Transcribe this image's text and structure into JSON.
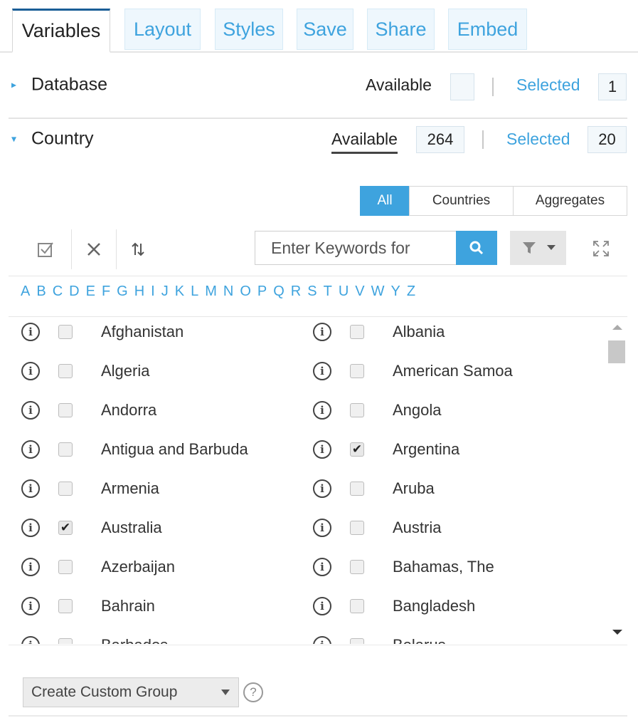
{
  "tabs": [
    {
      "label": "Variables",
      "active": true
    },
    {
      "label": "Layout"
    },
    {
      "label": "Styles"
    },
    {
      "label": "Save"
    },
    {
      "label": "Share"
    },
    {
      "label": "Embed"
    }
  ],
  "database": {
    "title": "Database",
    "available_label": "Available",
    "available_count": "",
    "selected_label": "Selected",
    "selected_count": "1"
  },
  "country": {
    "title": "Country",
    "available_label": "Available",
    "available_count": "264",
    "selected_label": "Selected",
    "selected_count": "20"
  },
  "filters": [
    "All",
    "Countries",
    "Aggregates"
  ],
  "search": {
    "placeholder": "Enter Keywords for"
  },
  "alphabet": [
    "A",
    "B",
    "C",
    "D",
    "E",
    "F",
    "G",
    "H",
    "I",
    "J",
    "K",
    "L",
    "M",
    "N",
    "O",
    "P",
    "Q",
    "R",
    "S",
    "T",
    "U",
    "V",
    "W",
    "Y",
    "Z"
  ],
  "countries_left": [
    {
      "name": "Afghanistan",
      "checked": false
    },
    {
      "name": "Algeria",
      "checked": false
    },
    {
      "name": "Andorra",
      "checked": false
    },
    {
      "name": "Antigua and Barbuda",
      "checked": false
    },
    {
      "name": "Armenia",
      "checked": false
    },
    {
      "name": "Australia",
      "checked": true
    },
    {
      "name": "Azerbaijan",
      "checked": false
    },
    {
      "name": "Bahrain",
      "checked": false
    },
    {
      "name": "Barbados",
      "checked": false
    }
  ],
  "countries_right": [
    {
      "name": "Albania",
      "checked": false
    },
    {
      "name": "American Samoa",
      "checked": false
    },
    {
      "name": "Angola",
      "checked": false
    },
    {
      "name": "Argentina",
      "checked": true
    },
    {
      "name": "Aruba",
      "checked": false
    },
    {
      "name": "Austria",
      "checked": false
    },
    {
      "name": "Bahamas, The",
      "checked": false
    },
    {
      "name": "Bangladesh",
      "checked": false
    },
    {
      "name": "Belarus",
      "checked": false
    }
  ],
  "footer": {
    "group_label": "Create Custom Group",
    "help": "?"
  },
  "colors": {
    "accent": "#3ea3de",
    "active_tab_border": "#1a5e97"
  },
  "icons": [
    "select-all-icon",
    "clear-icon",
    "sort-icon",
    "search-icon",
    "filter-icon",
    "expand-icon",
    "info-icon",
    "caret-right-icon",
    "caret-down-icon"
  ]
}
